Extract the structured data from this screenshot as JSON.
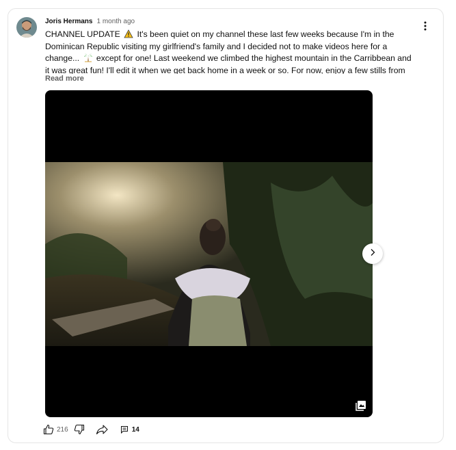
{
  "post": {
    "author": "Joris Hermans",
    "time": "1 month ago",
    "text_part1": "CHANNEL UPDATE ",
    "text_part2": " It's been quiet on my channel these last few weeks because I'm in the Dominican Republic visiting my girlfriend's family and I decided not to make videos here for a change... ",
    "text_part3": " except for one! Last weekend we climbed the highest mountain in the Carribbean and it was great fun! I'll edit it when we get back home in a week or so. For now, enjoy a few stills from our ..",
    "read_more": "Read more",
    "icons": {
      "warning": "warning-icon",
      "palm": "palm-tree-icon",
      "menu": "more-vert-icon",
      "gallery": "gallery-icon",
      "next": "chevron-right-icon"
    }
  },
  "actions": {
    "like_count": "216",
    "comment_count": "14"
  },
  "colors": {
    "text": "#0f0f0f",
    "secondary": "#606060",
    "border": "#e5e5e5"
  }
}
